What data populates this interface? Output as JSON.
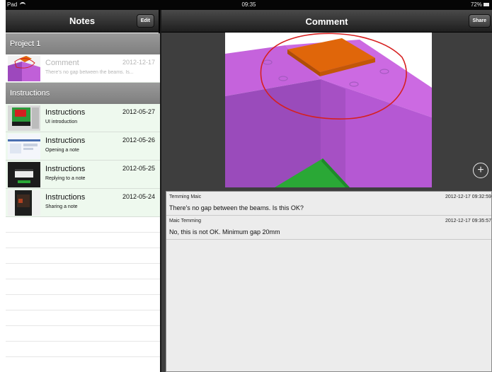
{
  "status_bar": {
    "device": "Pad",
    "time": "09:35",
    "battery": "72%"
  },
  "master": {
    "title": "Notes",
    "edit_label": "Edit",
    "sections": [
      {
        "header": "Project 1",
        "items": [
          {
            "title": "Comment",
            "date": "2012-12-17",
            "subtitle": "There's no gap between the beams. Is..."
          }
        ]
      },
      {
        "header": "Instructions",
        "items": [
          {
            "title": "Instructions",
            "date": "2012-05-27",
            "subtitle": "UI introduction"
          },
          {
            "title": "Instructions",
            "date": "2012-05-26",
            "subtitle": "Opening a note"
          },
          {
            "title": "Instructions",
            "date": "2012-05-25",
            "subtitle": "Replying to a note"
          },
          {
            "title": "Instructions",
            "date": "2012-05-24",
            "subtitle": "Sharing a note"
          }
        ]
      }
    ]
  },
  "detail": {
    "title": "Comment",
    "share_label": "Share",
    "add_label": "+",
    "comments": [
      {
        "author": "Temming Maic",
        "timestamp": "2012-12-17 09:32:59",
        "text": "There's no gap between the beams. Is this OK?"
      },
      {
        "author": "Maic Temming",
        "timestamp": "2012-12-17 09:35:57",
        "text": "No, this is not OK. Minimum gap 20mm"
      }
    ]
  },
  "colors": {
    "beam_purple": "#c060d8",
    "beam_shadow": "#8a3ea8",
    "plate_orange": "#e0660a",
    "annotation_red": "#d62020",
    "floor_green": "#2aa836",
    "row_green": "#eef9ee"
  }
}
